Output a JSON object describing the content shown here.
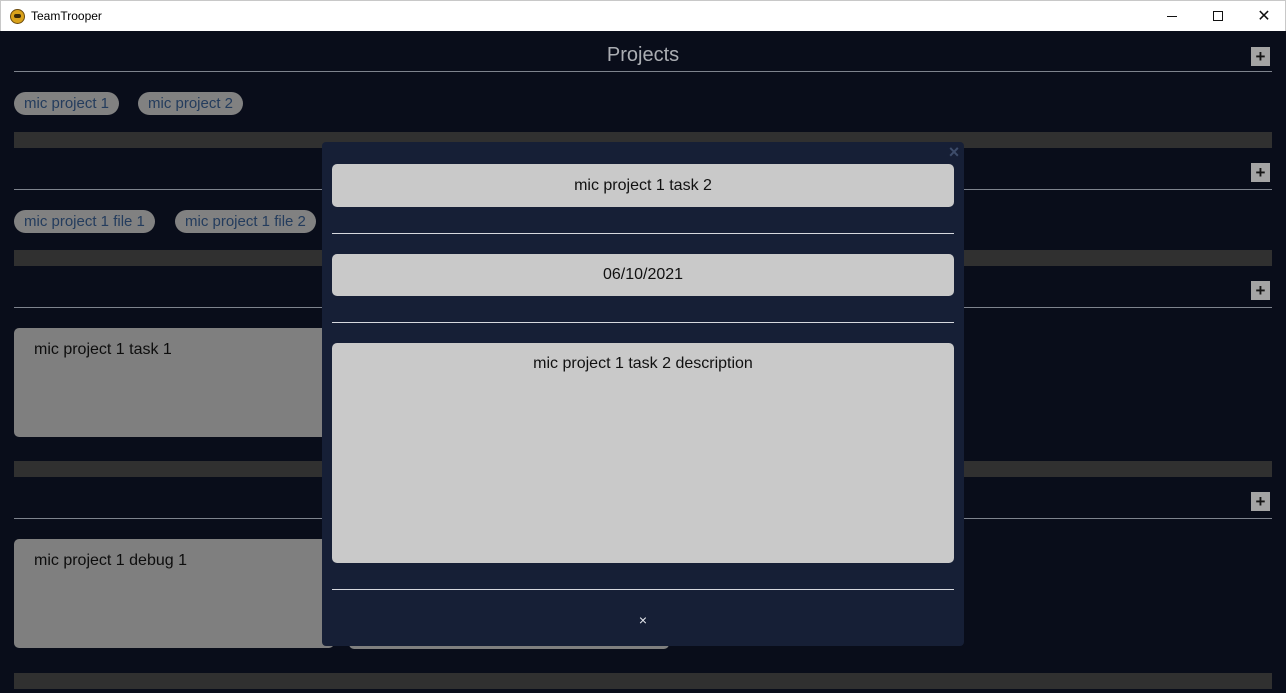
{
  "window": {
    "title": "TeamTrooper",
    "min_glyph": "",
    "max_glyph": "",
    "close_glyph": "✕"
  },
  "projects": {
    "title": "Projects",
    "add_glyph": "+",
    "items": [
      "mic project 1",
      "mic project 2"
    ]
  },
  "files": {
    "add_glyph": "+",
    "items": [
      "mic project 1 file 1",
      "mic project 1 file 2"
    ]
  },
  "tasks": {
    "add_glyph": "+",
    "items": [
      "mic project 1 task 1"
    ]
  },
  "debugs": {
    "add_glyph": "+",
    "items": [
      "mic project 1 debug 1"
    ]
  },
  "modal": {
    "close_top_glyph": "×",
    "task_name": "mic project 1 task 2",
    "date": "06/10/2021",
    "description": "mic project 1 task 2 description",
    "close_bottom_glyph": "×"
  },
  "colors": {
    "background": "#0c1120",
    "modal": "#161f36",
    "pill": "#9e9e9e",
    "pill_text": "#2c4a72",
    "card": "#9b9b9b",
    "field": "#c9c9c9"
  }
}
